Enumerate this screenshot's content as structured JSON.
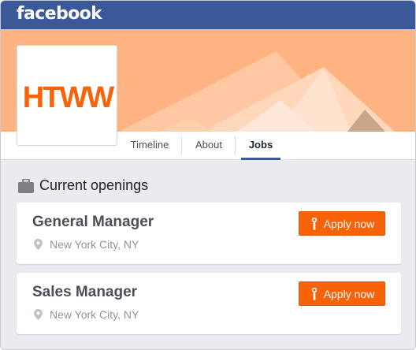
{
  "app": {
    "brand": "facebook"
  },
  "page": {
    "logo_text": "HTWW"
  },
  "tabs": [
    {
      "label": "Timeline"
    },
    {
      "label": "About"
    },
    {
      "label": "Jobs"
    }
  ],
  "section": {
    "title": "Current openings"
  },
  "jobs": [
    {
      "title": "General Manager",
      "location": "New York City, NY",
      "apply_label": "Apply now"
    },
    {
      "title": "Sales Manager",
      "location": "New York City, NY",
      "apply_label": "Apply now"
    }
  ],
  "colors": {
    "brand_blue": "#3b5998",
    "cover_orange": "#ffb380",
    "accent_orange": "#f8630a",
    "background": "#e9ebee"
  },
  "icons": {
    "briefcase": "briefcase-icon",
    "location": "map-pin-icon",
    "apply": "apply-info-icon"
  }
}
